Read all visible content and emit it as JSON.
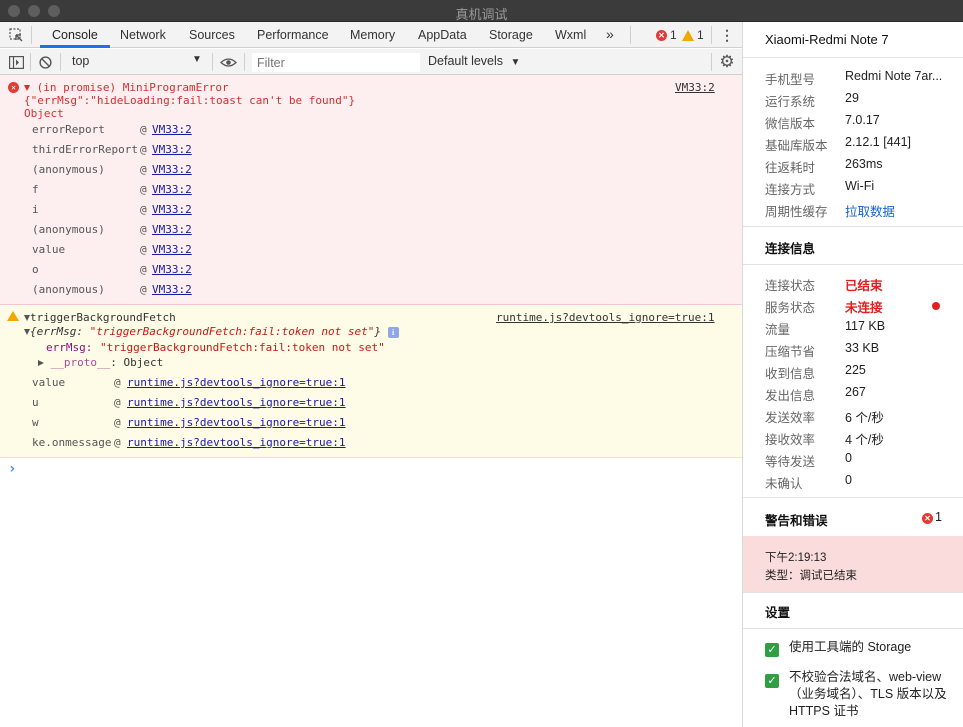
{
  "window": {
    "title": "真机调试"
  },
  "tabs": [
    {
      "label": "Console",
      "active": true
    },
    {
      "label": "Network"
    },
    {
      "label": "Sources"
    },
    {
      "label": "Performance"
    },
    {
      "label": "Memory"
    },
    {
      "label": "AppData"
    },
    {
      "label": "Storage"
    },
    {
      "label": "Wxml"
    }
  ],
  "tab_overflow": "»",
  "counts": {
    "errors": "1",
    "warnings": "1"
  },
  "toolbar": {
    "context": "top",
    "filter_placeholder": "Filter",
    "levels": "Default levels"
  },
  "console": {
    "error": {
      "header": "(in promise) MiniProgramError",
      "source": "VM33:2",
      "message": "{\"errMsg\":\"hideLoading:fail:toast can't be found\"}",
      "object": "Object",
      "stack": [
        {
          "fn": "errorReport",
          "at": "@",
          "src": "VM33:2"
        },
        {
          "fn": "thirdErrorReport",
          "at": "@",
          "src": "VM33:2"
        },
        {
          "fn": "(anonymous)",
          "at": "@",
          "src": "VM33:2"
        },
        {
          "fn": "f",
          "at": "@",
          "src": "VM33:2"
        },
        {
          "fn": "i",
          "at": "@",
          "src": "VM33:2"
        },
        {
          "fn": "(anonymous)",
          "at": "@",
          "src": "VM33:2"
        },
        {
          "fn": "value",
          "at": "@",
          "src": "VM33:2"
        },
        {
          "fn": "o",
          "at": "@",
          "src": "VM33:2"
        },
        {
          "fn": "(anonymous)",
          "at": "@",
          "src": "VM33:2"
        }
      ]
    },
    "warning": {
      "header": "triggerBackgroundFetch",
      "source": "runtime.js?devtools_ignore=true:1",
      "obj_open": "{errMsg: ",
      "obj_value": "\"triggerBackgroundFetch:fail:token not set\"",
      "obj_close": "}",
      "prop_key": "errMsg",
      "prop_value": "\"triggerBackgroundFetch:fail:token not set\"",
      "proto_key": "__proto__",
      "proto_value": ": Object",
      "stack": [
        {
          "fn": "value",
          "at": "@",
          "src": "runtime.js?devtools_ignore=true:1"
        },
        {
          "fn": "u",
          "at": "@",
          "src": "runtime.js?devtools_ignore=true:1"
        },
        {
          "fn": "w",
          "at": "@",
          "src": "runtime.js?devtools_ignore=true:1"
        },
        {
          "fn": "ke.onmessage",
          "at": "@",
          "src": "runtime.js?devtools_ignore=true:1"
        }
      ]
    },
    "prompt": "›"
  },
  "panel": {
    "device_title": "Xiaomi-Redmi Note 7",
    "device_info": [
      {
        "label": "手机型号",
        "value": "Redmi Note 7ar..."
      },
      {
        "label": "运行系统",
        "value": "29"
      },
      {
        "label": "微信版本",
        "value": "7.0.17"
      },
      {
        "label": "基础库版本",
        "value": "2.12.1 [441]"
      },
      {
        "label": "往返耗时",
        "value": "263ms"
      },
      {
        "label": "连接方式",
        "value": "Wi-Fi"
      },
      {
        "label": "周期性缓存",
        "value": "拉取数据"
      }
    ],
    "connection_title": "连接信息",
    "connection_info": [
      {
        "label": "连接状态",
        "value": "已结束"
      },
      {
        "label": "服务状态",
        "value": "未连接"
      },
      {
        "label": "流量",
        "value": "117 KB"
      },
      {
        "label": "压缩节省",
        "value": "33 KB"
      },
      {
        "label": "收到信息",
        "value": "225"
      },
      {
        "label": "发出信息",
        "value": "267"
      },
      {
        "label": "发送效率",
        "value": "6 个/秒"
      },
      {
        "label": "接收效率",
        "value": "4 个/秒"
      },
      {
        "label": "等待发送",
        "value": "0"
      },
      {
        "label": "未确认",
        "value": "0"
      }
    ],
    "alerts_title": "警告和错误",
    "alerts_count": "1",
    "alert": {
      "time": "下午2:19:13",
      "type": "类型：调试已结束"
    },
    "settings_title": "设置",
    "settings": [
      {
        "label": "使用工具端的 Storage",
        "checked": true
      },
      {
        "label": "不校验合法域名、web-view（业务域名）、TLS 版本以及 HTTPS 证书",
        "checked": true
      }
    ],
    "colors": {
      "status_red": "#e02020",
      "link_blue": "#1a5fd0",
      "check_green": "#2ea043",
      "alert_bg": "#fbdcdc"
    }
  }
}
